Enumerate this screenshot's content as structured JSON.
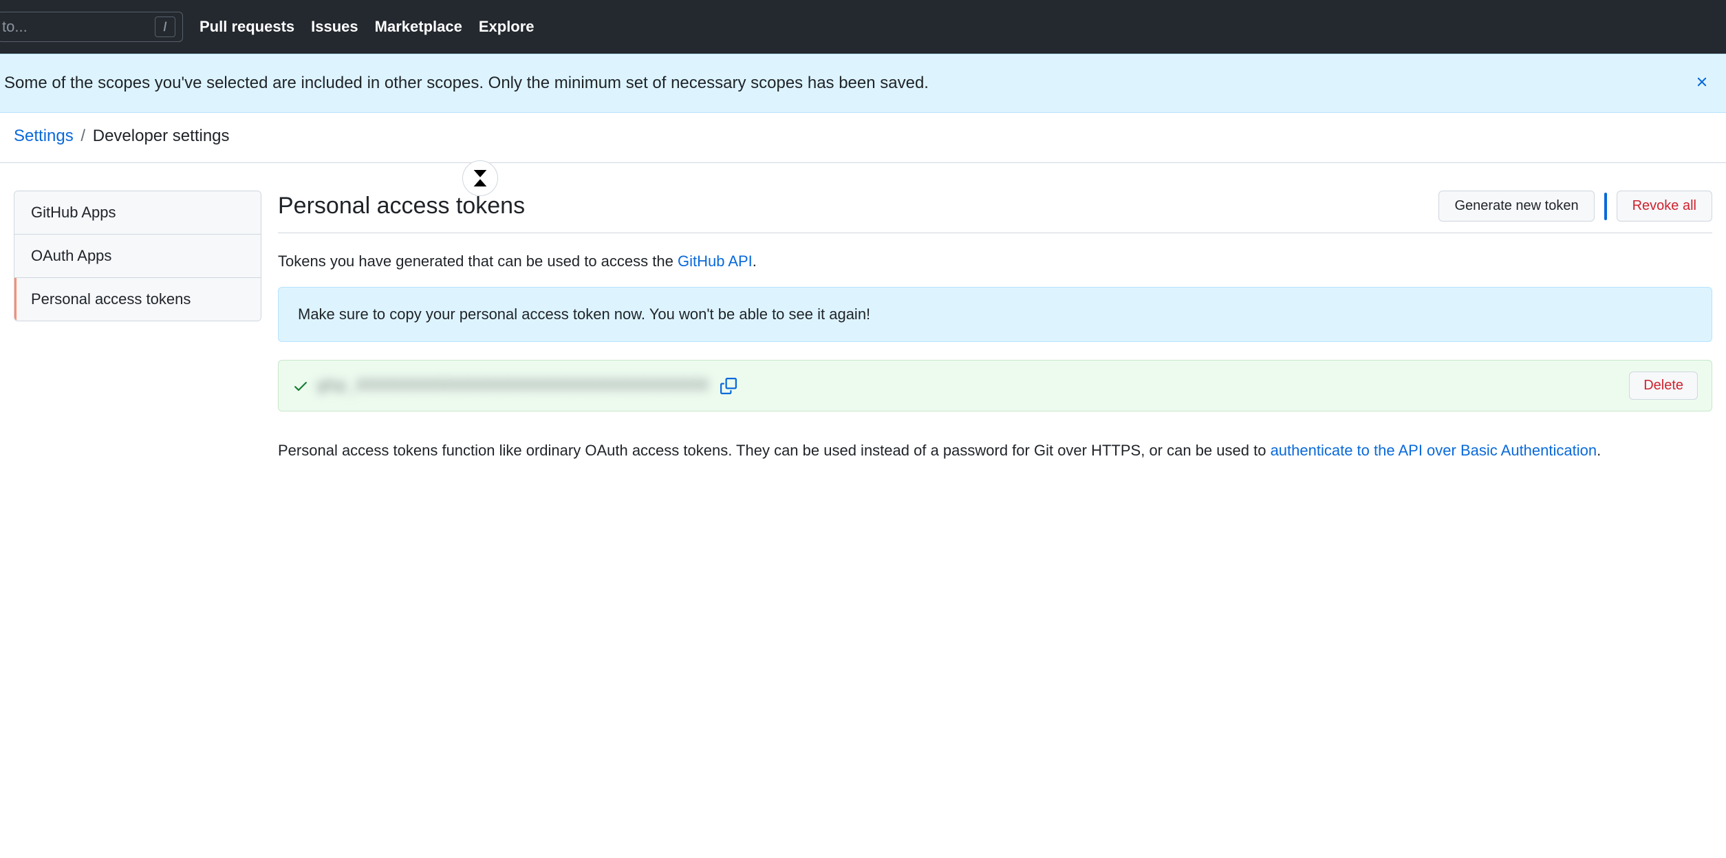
{
  "nav": {
    "search_placeholder": "to...",
    "slash_key": "/",
    "links": [
      "Pull requests",
      "Issues",
      "Marketplace",
      "Explore"
    ]
  },
  "flash": {
    "message": "Some of the scopes you've selected are included in other scopes. Only the minimum set of necessary scopes has been saved."
  },
  "breadcrumb": {
    "root": "Settings",
    "sep": "/",
    "current": "Developer settings"
  },
  "sidebar": {
    "items": [
      {
        "label": "GitHub Apps",
        "active": false
      },
      {
        "label": "OAuth Apps",
        "active": false
      },
      {
        "label": "Personal access tokens",
        "active": true
      }
    ]
  },
  "page": {
    "title": "Personal access tokens",
    "generate_btn": "Generate new token",
    "revoke_btn": "Revoke all",
    "intro_before": "Tokens you have generated that can be used to access the ",
    "intro_link": "GitHub API",
    "intro_after": ".",
    "copy_warning": "Make sure to copy your personal access token now. You won't be able to see it again!",
    "token_value": "ghp_XXXXXXXXXXXXXXXXXXXXXXXXXXXXXXXXXXXX",
    "delete_btn": "Delete",
    "footer_before": "Personal access tokens function like ordinary OAuth access tokens. They can be used instead of a password for Git over HTTPS, or can be used to ",
    "footer_link": "authenticate to the API over Basic Authentication",
    "footer_after": "."
  }
}
